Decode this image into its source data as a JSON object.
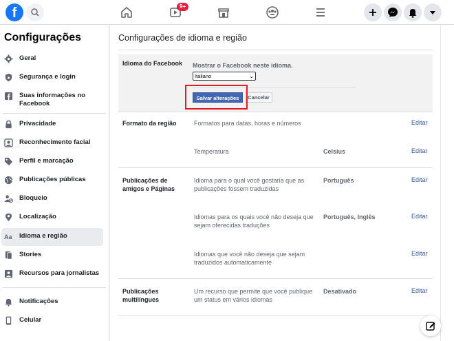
{
  "topbar": {
    "logo": "f",
    "badge": "9+"
  },
  "sidebar": {
    "title": "Configurações",
    "items": [
      {
        "label": "Geral",
        "icon": "gear-icon"
      },
      {
        "label": "Segurança e login",
        "icon": "shield-icon"
      },
      {
        "label": "Suas informações no Facebook",
        "icon": "facebook-icon"
      },
      {
        "label": "Privacidade",
        "icon": "lock-icon"
      },
      {
        "label": "Reconhecimento facial",
        "icon": "face-icon"
      },
      {
        "label": "Perfil e marcação",
        "icon": "tag-icon"
      },
      {
        "label": "Publicações públicas",
        "icon": "globe-icon"
      },
      {
        "label": "Bloqueio",
        "icon": "block-user-icon"
      },
      {
        "label": "Localização",
        "icon": "location-pin-icon"
      },
      {
        "label": "Idioma e região",
        "icon": "language-icon",
        "active": true,
        "glyph": "Aa"
      },
      {
        "label": "Stories",
        "icon": "book-icon"
      },
      {
        "label": "Recursos para jornalistas",
        "icon": "journalist-icon"
      },
      {
        "label": "Notificações",
        "icon": "bell-icon"
      },
      {
        "label": "Celular",
        "icon": "phone-icon"
      }
    ]
  },
  "main": {
    "title": "Configurações de idioma e região",
    "language": {
      "label": "Idioma do Facebook",
      "prompt": "Mostrar o Facebook neste idioma.",
      "selected": "Italiano",
      "save_label": "Salvar alterações",
      "cancel_label": "Cancelar"
    },
    "region": {
      "label": "Formato da região",
      "rows": [
        {
          "desc": "Formatos para datas, horas e números",
          "value": "",
          "edit": "Editar"
        },
        {
          "desc": "Temperatura",
          "value": "Celsius",
          "edit": "Editar"
        }
      ]
    },
    "friends_posts": {
      "label_line1": "Publicações de",
      "label_line2": "amigos e Páginas",
      "rows": [
        {
          "desc_line1": "Idioma para o qual você gostaria que as",
          "desc_line2": "publicações fossem traduzidas",
          "value": "Português",
          "edit": "Editar"
        },
        {
          "desc_line1": "Idiomas para os quais você não deseja que",
          "desc_line2": "sejam oferecidas traduções",
          "value": "Português, Inglês",
          "edit": "Editar"
        },
        {
          "desc_line1": "Idiomas que você não deseja que sejam",
          "desc_line2": "traduzidos automaticamente",
          "value": "",
          "edit": "Editar"
        }
      ]
    },
    "multilingual": {
      "label_line1": "Publicações",
      "label_line2": "multilíngues",
      "desc_line1": "Um recurso que permite que você publique",
      "desc_line2": "um status em vários idiomas",
      "value": "Desativado",
      "edit": "Editar"
    }
  },
  "colors": {
    "brand": "#1877f2",
    "link": "#385898",
    "button": "#4267b2",
    "highlight": "#e21b1b"
  }
}
